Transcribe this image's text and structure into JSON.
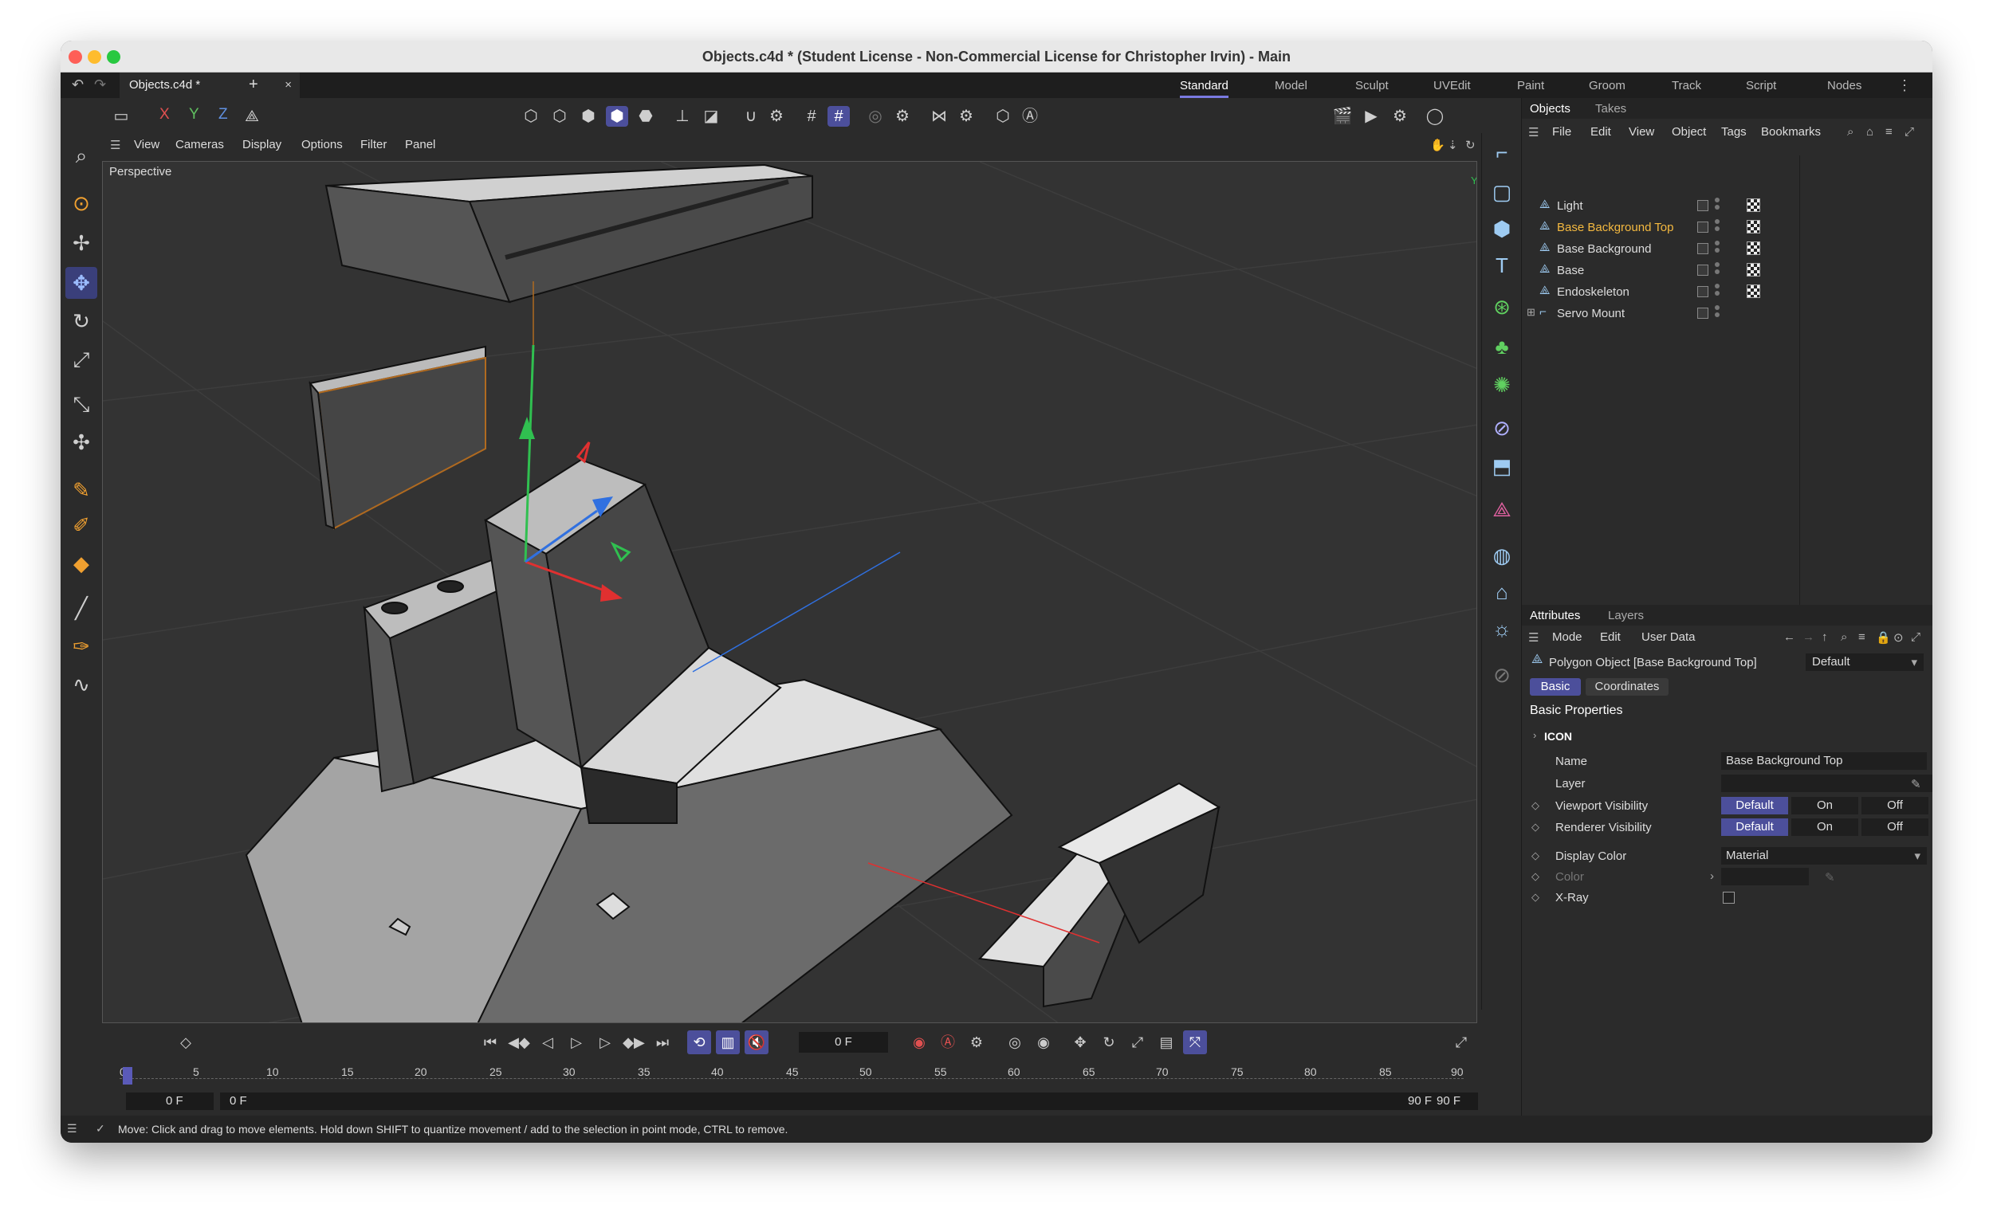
{
  "window": {
    "title": "Objects.c4d * (Student License - Non-Commercial License for Christopher Irvin) - Main"
  },
  "tabs": {
    "doc_tab": "Objects.c4d *",
    "close": "×",
    "new": "+"
  },
  "layouts": [
    "Standard",
    "Model",
    "Sculpt",
    "UVEdit",
    "Paint",
    "Groom",
    "Track",
    "Script",
    "Nodes"
  ],
  "axes": {
    "x": "X",
    "y": "Y",
    "z": "Z"
  },
  "viewport": {
    "menu": [
      "View",
      "Cameras",
      "Display",
      "Options",
      "Filter",
      "Panel"
    ],
    "label": "Perspective"
  },
  "timeline": {
    "current_frame": "0 F",
    "ruler": [
      "0",
      "5",
      "10",
      "15",
      "20",
      "25",
      "30",
      "35",
      "40",
      "45",
      "50",
      "55",
      "60",
      "65",
      "70",
      "75",
      "80",
      "85",
      "90"
    ],
    "start_a": "0 F",
    "start_b": "0 F",
    "end_a": "90 F",
    "end_b": "90 F",
    "playhead_frame": 0
  },
  "status": {
    "message": "Move: Click and drag to move elements. Hold down SHIFT to quantize movement / add to the selection in point mode, CTRL to remove."
  },
  "objects_panel": {
    "tabs": [
      "Objects",
      "Takes"
    ],
    "menu": [
      "File",
      "Edit",
      "View",
      "Object",
      "Tags",
      "Bookmarks"
    ],
    "items": [
      {
        "name": "Light",
        "selected": false
      },
      {
        "name": "Base Background Top",
        "selected": true
      },
      {
        "name": "Base Background",
        "selected": false
      },
      {
        "name": "Base",
        "selected": false
      },
      {
        "name": "Endoskeleton",
        "selected": false
      },
      {
        "name": "Servo Mount",
        "selected": false
      }
    ],
    "selected_color": "#f4b940"
  },
  "attributes_panel": {
    "tabs": [
      "Attributes",
      "Layers"
    ],
    "menu": [
      "Mode",
      "Edit",
      "User Data"
    ],
    "object_title": "Polygon Object [Base Background Top]",
    "preset": "Default",
    "subtabs": [
      "Basic",
      "Coordinates"
    ],
    "section": "Basic Properties",
    "icon_group": "ICON",
    "props": {
      "name_label": "Name",
      "name_value": "Base Background Top",
      "layer_label": "Layer",
      "viewport_label": "Viewport Visibility",
      "renderer_label": "Renderer Visibility",
      "vis_options": [
        "Default",
        "On",
        "Off"
      ],
      "display_color_label": "Display Color",
      "display_color_value": "Material",
      "color_label": "Color",
      "xray_label": "X-Ray"
    }
  },
  "colors": {
    "accent": "#4c4f9b",
    "viewport_bg": "#333333",
    "axis_x": "#e03030",
    "axis_y": "#30c050",
    "axis_z": "#3070e0"
  }
}
